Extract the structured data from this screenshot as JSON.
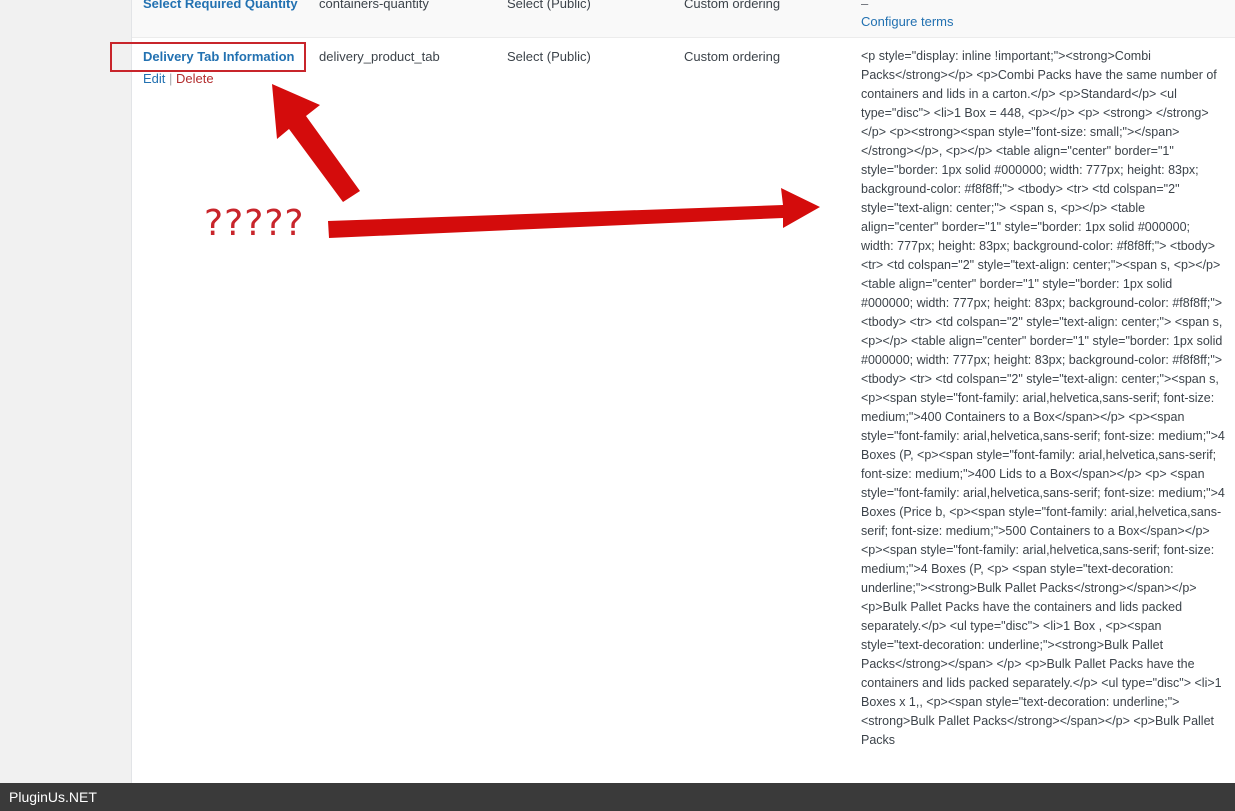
{
  "rows": {
    "prev": {
      "name": "Select Required Quantity",
      "slug": "containers-quantity",
      "type": "Select (Public)",
      "order": "Custom ordering",
      "dash": "–",
      "configure": "Configure terms"
    },
    "main": {
      "name": "Delivery Tab Information",
      "edit": "Edit",
      "sep": "|",
      "delete": "Delete",
      "slug": "delivery_product_tab",
      "type": "Select (Public)",
      "order": "Custom ordering",
      "description": "<p style=\"display: inline !important;\"><strong>Combi Packs</strong></p> <p>Combi Packs have the same number of containers and lids in a carton.</p> <p>Standard</p> <ul type=\"disc\"> <li>1 Box = 448, <p></p> <p> <strong> </strong></p> <p><strong><span style=\"font-size: small;\"></span></strong></p>, <p></p> <table align=\"center\" border=\"1\" style=\"border: 1px solid #000000; width: 777px; height: 83px; background-color: #f8f8ff;\"> <tbody> <tr> <td colspan=\"2\" style=\"text-align: center;\"> <span s, <p></p> <table align=\"center\" border=\"1\" style=\"border: 1px solid #000000; width: 777px; height: 83px; background-color: #f8f8ff;\"> <tbody> <tr> <td colspan=\"2\" style=\"text-align: center;\"><span s, <p></p> <table align=\"center\" border=\"1\" style=\"border: 1px solid #000000; width: 777px; height: 83px; background-color: #f8f8ff;\"> <tbody> <tr> <td colspan=\"2\" style=\"text-align: center;\"> <span s, <p></p> <table align=\"center\" border=\"1\" style=\"border: 1px solid #000000; width: 777px; height: 83px; background-color: #f8f8ff;\"> <tbody> <tr> <td colspan=\"2\" style=\"text-align: center;\"><span s, <p><span style=\"font-family: arial,helvetica,sans-serif; font-size: medium;\">400 Containers to a Box</span></p> <p><span style=\"font-family: arial,helvetica,sans-serif; font-size: medium;\">4 Boxes (P, <p><span style=\"font-family: arial,helvetica,sans-serif; font-size: medium;\">400 Lids to a Box</span></p> <p> <span style=\"font-family: arial,helvetica,sans-serif; font-size: medium;\">4 Boxes (Price b, <p><span style=\"font-family: arial,helvetica,sans-serif; font-size: medium;\">500 Containers to a Box</span></p> <p><span style=\"font-family: arial,helvetica,sans-serif; font-size: medium;\">4 Boxes (P, <p> <span style=\"text-decoration: underline;\"><strong>Bulk Pallet Packs</strong></span></p> <p>Bulk Pallet Packs have the containers and lids packed separately.</p> <ul type=\"disc\"> <li>1 Box , <p><span style=\"text-decoration: underline;\"><strong>Bulk Pallet Packs</strong></span> </p> <p>Bulk Pallet Packs have the containers and lids packed separately.</p> <ul type=\"disc\"> <li>1 Boxes x 1,, <p><span style=\"text-decoration: underline;\"><strong>Bulk Pallet Packs</strong></span></p> <p>Bulk Pallet Packs"
    }
  },
  "annotation": {
    "text": "?????",
    "color": "#c8252b"
  },
  "footer": {
    "watermark": "PluginUs.NET"
  }
}
